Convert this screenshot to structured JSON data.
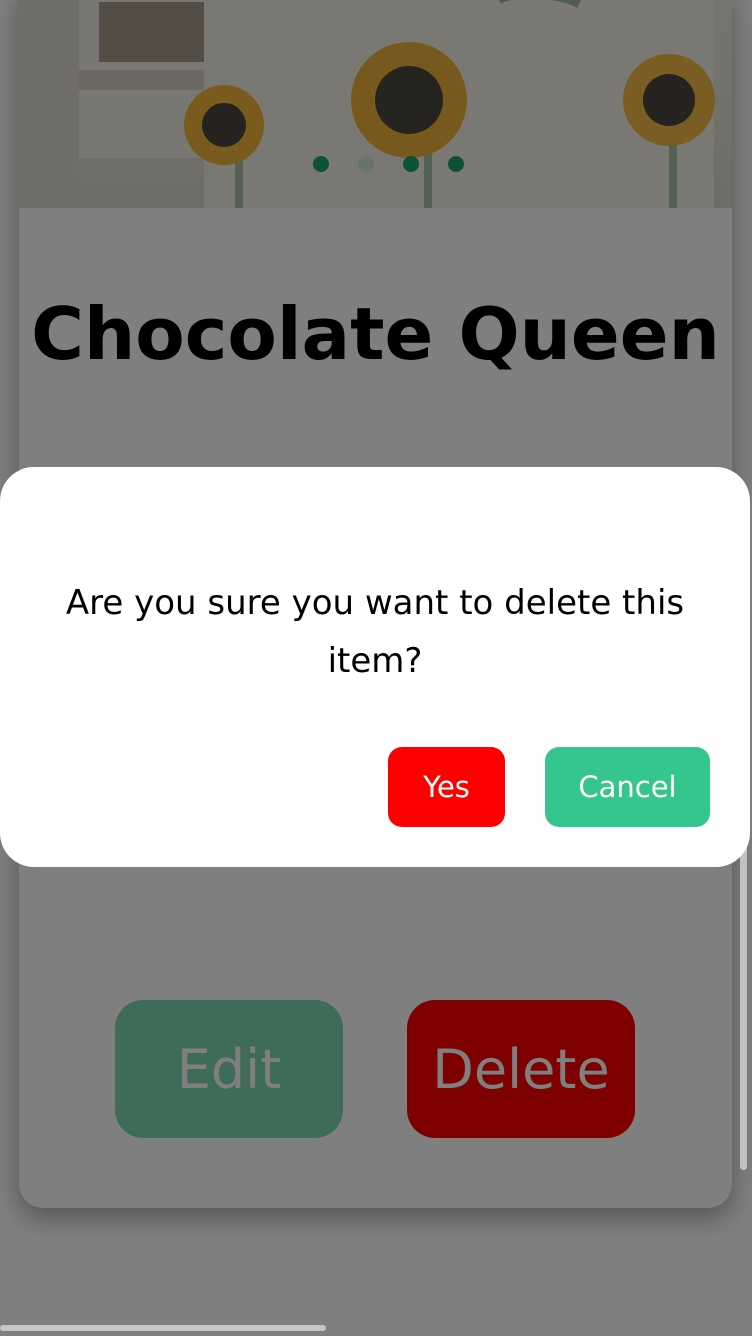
{
  "product": {
    "title": "Chocolate Queen",
    "carousel": {
      "active_color": "#1aa36f",
      "inactive_color": "#cfe6dc",
      "dots": [
        {
          "active": true
        },
        {
          "active": false
        },
        {
          "active": true
        },
        {
          "active": true
        }
      ]
    }
  },
  "actions": {
    "edit_label": "Edit",
    "delete_label": "Delete",
    "edit_color": "#7fd8b3",
    "delete_color": "#ff0000"
  },
  "dialog": {
    "message": "Are you sure you want to delete this item?",
    "yes_label": "Yes",
    "cancel_label": "Cancel",
    "yes_color": "#ff0000",
    "cancel_color": "#34c68c"
  }
}
